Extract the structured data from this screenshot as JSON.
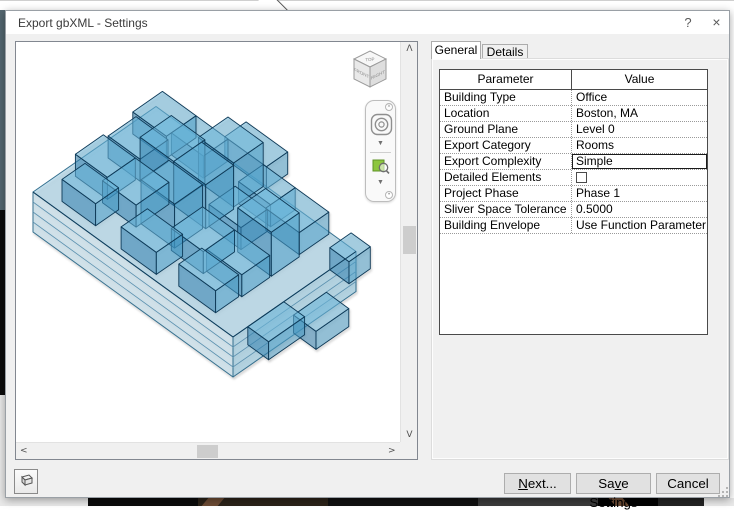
{
  "window": {
    "title": "Export gbXML - Settings",
    "help_icon": "?",
    "close_icon": "×"
  },
  "tabs": {
    "general": "General",
    "details": "Details"
  },
  "table": {
    "col_param": "Parameter",
    "col_value": "Value",
    "rows": [
      {
        "param": "Building Type",
        "value": "Office"
      },
      {
        "param": "Location",
        "value": "Boston, MA"
      },
      {
        "param": "Ground Plane",
        "value": "Level 0"
      },
      {
        "param": "Export Category",
        "value": "Rooms"
      },
      {
        "param": "Export Complexity",
        "value": "Simple",
        "selected": true
      },
      {
        "param": "Detailed Elements",
        "value": "",
        "type": "checkbox",
        "checked": false
      },
      {
        "param": "Project Phase",
        "value": "Phase 1"
      },
      {
        "param": "Sliver Space Tolerance",
        "value": "0.5000"
      },
      {
        "param": "Building Envelope",
        "value": "Use Function Parameter"
      }
    ]
  },
  "viewcube": {
    "top": "TOP",
    "front": "FRONT",
    "right": "RIGHT"
  },
  "scrollbars": {
    "up": "ᐱ",
    "down": "ᐯ",
    "left": "<",
    "right": ">",
    "up_fallback": "^",
    "down_fallback": "v"
  },
  "navbar": {
    "collapse_glyph": "×",
    "options_glyph": "•",
    "caret": "▼"
  },
  "footer": {
    "next": {
      "pre": "",
      "key": "N",
      "post": "ext..."
    },
    "save": {
      "pre": "Sa",
      "key": "v",
      "post": "e Settings"
    },
    "cancel": {
      "pre": "Cancel",
      "key": "",
      "post": ""
    }
  },
  "colors": {
    "model_edge": "#0e3a58",
    "room_top": "#6cb8dd",
    "room_left": "#2f80b0",
    "room_right": "#4a9fca",
    "base_top": "#9fd0e8",
    "base_left": "#c3e1f0",
    "base_right": "#8ec6e0",
    "base_edge": "#35708f",
    "band_line": "#5d92b0",
    "selection_border": "#1a1a1a"
  }
}
